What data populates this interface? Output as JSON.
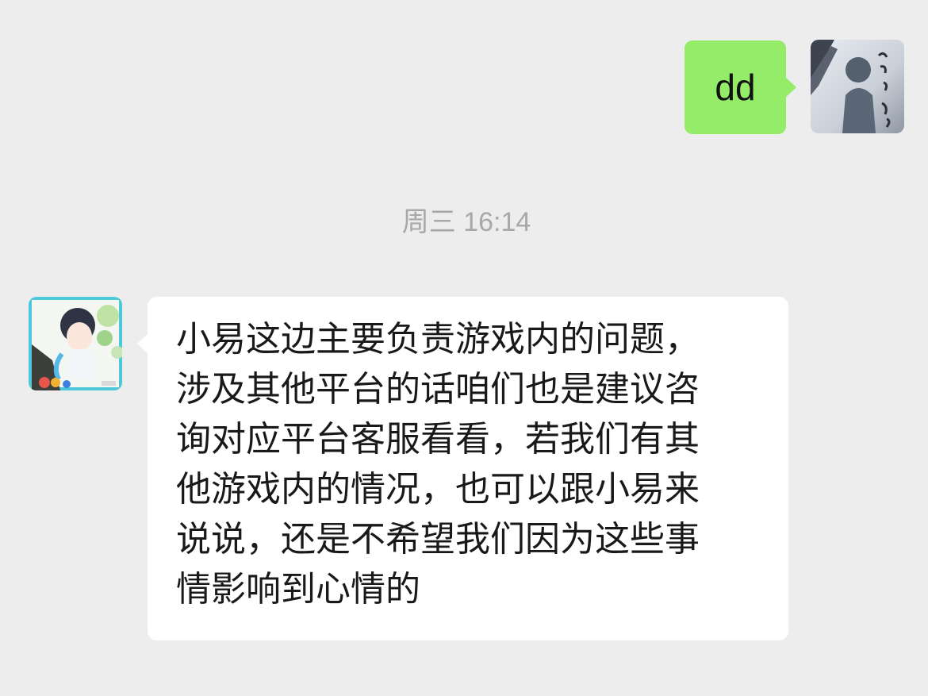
{
  "chat": {
    "outgoing": {
      "text": "dd",
      "avatar": "user-avatar-silhouette"
    },
    "timestamp": "周三 16:14",
    "incoming": {
      "text": "小易这边主要负责游戏内的问题，\n涉及其他平台的话咱们也是建议咨\n询对应平台客服看看，若我们有其\n他游戏内的情况，也可以跟小易来\n说说，还是不希望我们因为这些事\n情影响到心情的",
      "avatar": "support-agent-avatar"
    }
  },
  "colors": {
    "background": "#ededed",
    "outgoing_bubble": "#95ec69",
    "incoming_bubble": "#ffffff",
    "timestamp": "#a8a8a8"
  }
}
